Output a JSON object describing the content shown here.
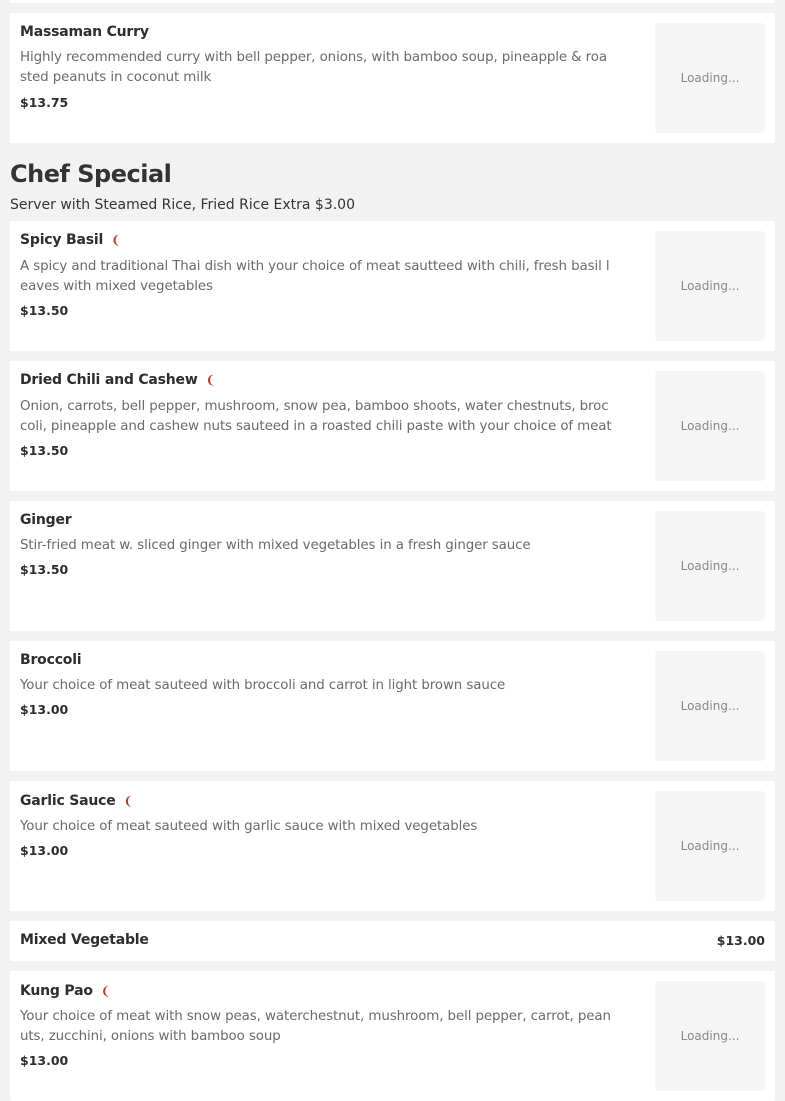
{
  "items_top": [
    {
      "name": "Massaman Curry",
      "spicy": false,
      "desc_lines": [
        "Highly recommended curry with bell pepper, onions, with bamboo soup, pineapple & roa",
        "sted peanuts in coconut milk"
      ],
      "price": "$13.75",
      "image_status": "Loading..."
    }
  ],
  "section": {
    "title": "Chef Special",
    "subtitle": "Server with Steamed Rice, Fried Rice Extra $3.00"
  },
  "items": [
    {
      "name": "Spicy Basil",
      "spicy": true,
      "desc_lines": [
        "A spicy and traditional Thai dish with your choice of meat sautteed with chili, fresh basil l",
        "eaves with mixed vegetables"
      ],
      "price": "$13.50",
      "image_status": "Loading..."
    },
    {
      "name": "Dried Chili and Cashew",
      "spicy": true,
      "desc_lines": [
        "Onion, carrots, bell pepper, mushroom, snow pea, bamboo shoots, water chestnuts, broc",
        "coli, pineapple and cashew nuts sauteed in a roasted chili paste with your choice of meat"
      ],
      "price": "$13.50",
      "image_status": "Loading..."
    },
    {
      "name": "Ginger",
      "spicy": false,
      "desc_lines": [
        "Stir-fried meat w. sliced ginger with mixed vegetables in a fresh ginger sauce"
      ],
      "price": "$13.50",
      "image_status": "Loading..."
    },
    {
      "name": "Broccoli",
      "spicy": false,
      "desc_lines": [
        "Your choice of meat sauteed with broccoli and carrot in light brown sauce"
      ],
      "price": "$13.00",
      "image_status": "Loading..."
    },
    {
      "name": "Garlic Sauce",
      "spicy": true,
      "desc_lines": [
        "Your choice of meat sauteed with garlic sauce with mixed vegetables"
      ],
      "price": "$13.00",
      "image_status": "Loading..."
    }
  ],
  "simple_item": {
    "name": "Mixed Vegetable",
    "price": "$13.00"
  },
  "last_item": {
    "name": "Kung Pao",
    "spicy": true,
    "desc_lines": [
      "Your choice of meat with snow peas, waterchestnut, mushroom, bell pepper, carrot, pean",
      "uts, zucchini, onions with bamboo soup"
    ],
    "price": "$13.00",
    "image_status": "Loading..."
  },
  "colors": {
    "chili": "#c0392b",
    "background": "#f2f2f2",
    "card": "#ffffff"
  },
  "icons": {
    "spicy": "chili-pepper-icon"
  }
}
